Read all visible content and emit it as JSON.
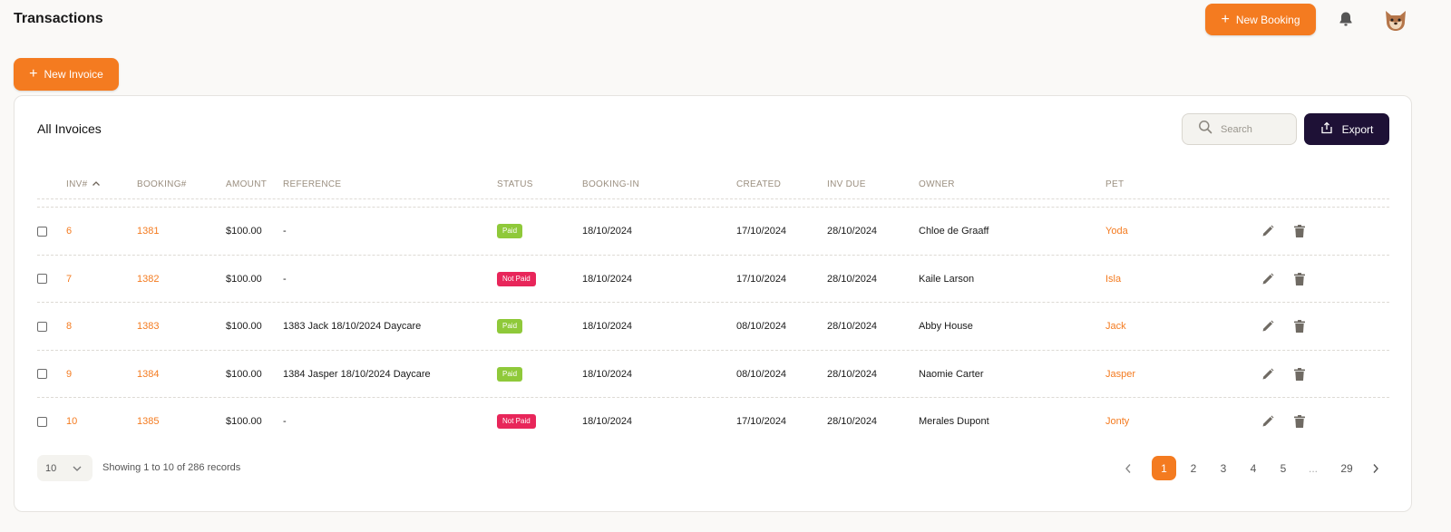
{
  "header": {
    "title": "Transactions",
    "new_booking_label": "New Booking"
  },
  "new_invoice_label": "New Invoice",
  "card": {
    "title": "All Invoices",
    "search_placeholder": "Search",
    "export_label": "Export"
  },
  "columns": {
    "inv": "INV#",
    "booking": "BOOKING#",
    "amount": "AMOUNT",
    "reference": "REFERENCE",
    "status": "STATUS",
    "booking_in": "BOOKING-IN",
    "created": "CREATED",
    "inv_due": "INV DUE",
    "owner": "OWNER",
    "pet": "PET"
  },
  "rows": [
    {
      "inv": "6",
      "booking": "1381",
      "amount": "$100.00",
      "reference": "-",
      "status": "Paid",
      "paid": true,
      "booking_in": "18/10/2024",
      "created": "17/10/2024",
      "inv_due": "28/10/2024",
      "owner": "Chloe de Graaff",
      "pet": "Yoda"
    },
    {
      "inv": "7",
      "booking": "1382",
      "amount": "$100.00",
      "reference": "-",
      "status": "Not Paid",
      "paid": false,
      "booking_in": "18/10/2024",
      "created": "17/10/2024",
      "inv_due": "28/10/2024",
      "owner": "Kaile Larson",
      "pet": "Isla"
    },
    {
      "inv": "8",
      "booking": "1383",
      "amount": "$100.00",
      "reference": "1383 Jack 18/10/2024 Daycare",
      "status": "Paid",
      "paid": true,
      "booking_in": "18/10/2024",
      "created": "08/10/2024",
      "inv_due": "28/10/2024",
      "owner": "Abby House",
      "pet": "Jack"
    },
    {
      "inv": "9",
      "booking": "1384",
      "amount": "$100.00",
      "reference": "1384 Jasper 18/10/2024 Daycare",
      "status": "Paid",
      "paid": true,
      "booking_in": "18/10/2024",
      "created": "08/10/2024",
      "inv_due": "28/10/2024",
      "owner": "Naomie Carter",
      "pet": "Jasper"
    },
    {
      "inv": "10",
      "booking": "1385",
      "amount": "$100.00",
      "reference": "-",
      "status": "Not Paid",
      "paid": false,
      "booking_in": "18/10/2024",
      "created": "17/10/2024",
      "inv_due": "28/10/2024",
      "owner": "Merales Dupont",
      "pet": "Jonty"
    }
  ],
  "footer": {
    "page_size": "10",
    "showing_text": "Showing 1 to 10 of 286 records",
    "pages": [
      "1",
      "2",
      "3",
      "4",
      "5",
      "...",
      "29"
    ],
    "current_page": "1"
  },
  "colors": {
    "accent": "#f47b20",
    "export_bg": "#1e1136",
    "paid": "#8fc93a",
    "not_paid": "#e8265a"
  }
}
